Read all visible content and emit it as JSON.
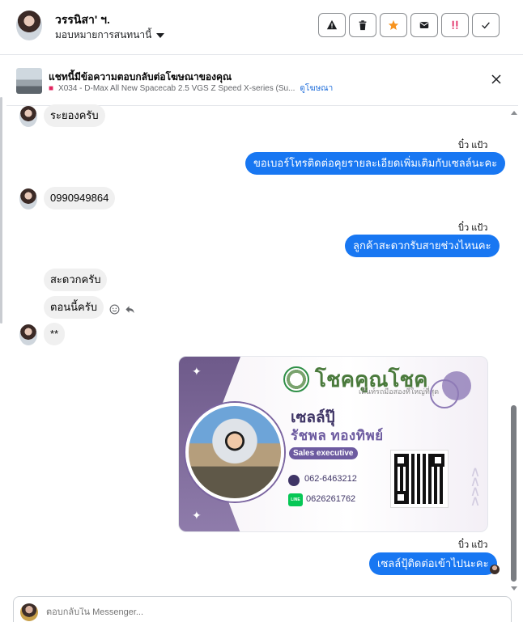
{
  "header": {
    "contact_name": "วรรนิสา' ฯ.",
    "assign_label": "มอบหมายการสนทนานี้"
  },
  "toolbar": {
    "icons": [
      "warning-icon",
      "trash-icon",
      "star-icon",
      "envelope-icon",
      "spam-icon",
      "check-icon"
    ],
    "star_color": "#f7931e",
    "spam_color": "#e0245e"
  },
  "ad_banner": {
    "title": "แชทนี้มีข้อความตอบกลับต่อโฆษณาของคุณ",
    "product": "X034 - D-Max All New Spacecab 2.5 VGS Z Speed X-series (Su...",
    "view_ad": "ดูโฆษณา"
  },
  "messages": {
    "m1": "ระยองครับ",
    "sender1": "บิ๋ว แป้ว",
    "m2": "ขอเบอร์โทรติดต่อคุยรายละเอียดเพิ่มเติมกับเซลล์นะคะ",
    "m3": "0990949864",
    "sender2": "บิ๋ว แป้ว",
    "m4": "ลูกค้าสะดวกรับสายช่วงไหนคะ",
    "m5": "สะดวกครับ",
    "m6": "ตอนนี้ครับ",
    "m7": "**",
    "sender3": "บิ๋ว แป้ว",
    "m8": "เซลล์ปุ้ติดต่อเข้าไปนะคะ"
  },
  "business_card": {
    "brand": "โชคคูณโชค",
    "tagline": "เต็นท์รถมือสองที่ใหญ่ที่สุด",
    "nickname": "เซลล์ปุ๊",
    "full_name": "รัชพล ทองทิพย์",
    "role": "Sales executive",
    "phone": "062-6463212",
    "line_id": "0626261762",
    "line_badge": "LINE"
  },
  "composer": {
    "placeholder": "ตอบกลับใน Messenger..."
  },
  "colors": {
    "outgoing_bubble": "#1877f2",
    "incoming_bubble": "#f0f0f0",
    "card_accent": "#6d5ba0"
  }
}
